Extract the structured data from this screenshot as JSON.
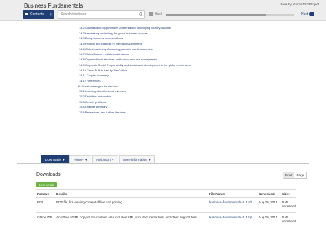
{
  "header": {
    "book_title": "Business Fundamentals",
    "book_by": "Book by: Global Text Project",
    "contents_label": "Contents",
    "search_placeholder": "Search this book",
    "back_label": "Back",
    "next_label": "Next",
    "progress_fraction": 0.78
  },
  "toc": [
    {
      "label": "14.2 Globalization: opportunities and threats to developing country business",
      "level": "sub"
    },
    {
      "label": "14.3 Harnessing technology for global business success",
      "level": "sub"
    },
    {
      "label": "14.4 Doing business across cultures",
      "level": "sub"
    },
    {
      "label": "14.5 Political and legal risk in international business",
      "level": "sub"
    },
    {
      "label": "14.6 Global marketing: Assessing potential markets overseas",
      "level": "sub"
    },
    {
      "label": "14.7 Global finance: initial considerations",
      "level": "sub"
    },
    {
      "label": "14.8 Organizational structure and human resource management",
      "level": "sub"
    },
    {
      "label": "14.9 Corporate Social Responsibility and sustainable development in the global environment",
      "level": "sub"
    },
    {
      "label": "14.10 Case: Built to Last by Jim Collins",
      "level": "sub"
    },
    {
      "label": "14.11 Chapter summary",
      "level": "sub"
    },
    {
      "label": "14.12 References",
      "level": "sub"
    },
    {
      "label": "15 Growth strategies for start-ups",
      "level": "chapter"
    },
    {
      "label": "15.1 Learning objectives and overview",
      "level": "sub"
    },
    {
      "label": "15.2 Definition and models",
      "level": "sub"
    },
    {
      "label": "15.3 Growth problems",
      "level": "sub"
    },
    {
      "label": "15.4 Chapter summary",
      "level": "sub"
    },
    {
      "label": "15.5 References, and further literature",
      "level": "sub"
    }
  ],
  "tabs": [
    {
      "label": "Downloads",
      "active": true
    },
    {
      "label": "History",
      "active": false
    },
    {
      "label": "Attribution",
      "active": false
    },
    {
      "label": "More information",
      "active": false
    }
  ],
  "downloads": {
    "heading": "Downloads",
    "view_book": "Book",
    "view_page": "Page",
    "less_details": "Less details",
    "columns": {
      "format": "Format:",
      "details": "Details",
      "file_name": "File Name:",
      "generated": "Generated:",
      "size": "Size:"
    },
    "rows": [
      {
        "format": "PDF",
        "details": "PDF file, for viewing content offline and printing.",
        "file_name": "business-fundamentals-4.3.pdf",
        "generated": "Aug 29, 2017",
        "size": "NaN undefined"
      },
      {
        "format": "Offline ZIP",
        "details": "An offline HTML copy of the content. Also includes XML, included media files, and other support files.",
        "file_name": "business-fundamentals-4.3.zip",
        "generated": "Aug 29, 2017",
        "size": "NaN undefined"
      }
    ]
  },
  "colors": {
    "accent": "#1f3f74",
    "green": "#6bb343"
  }
}
